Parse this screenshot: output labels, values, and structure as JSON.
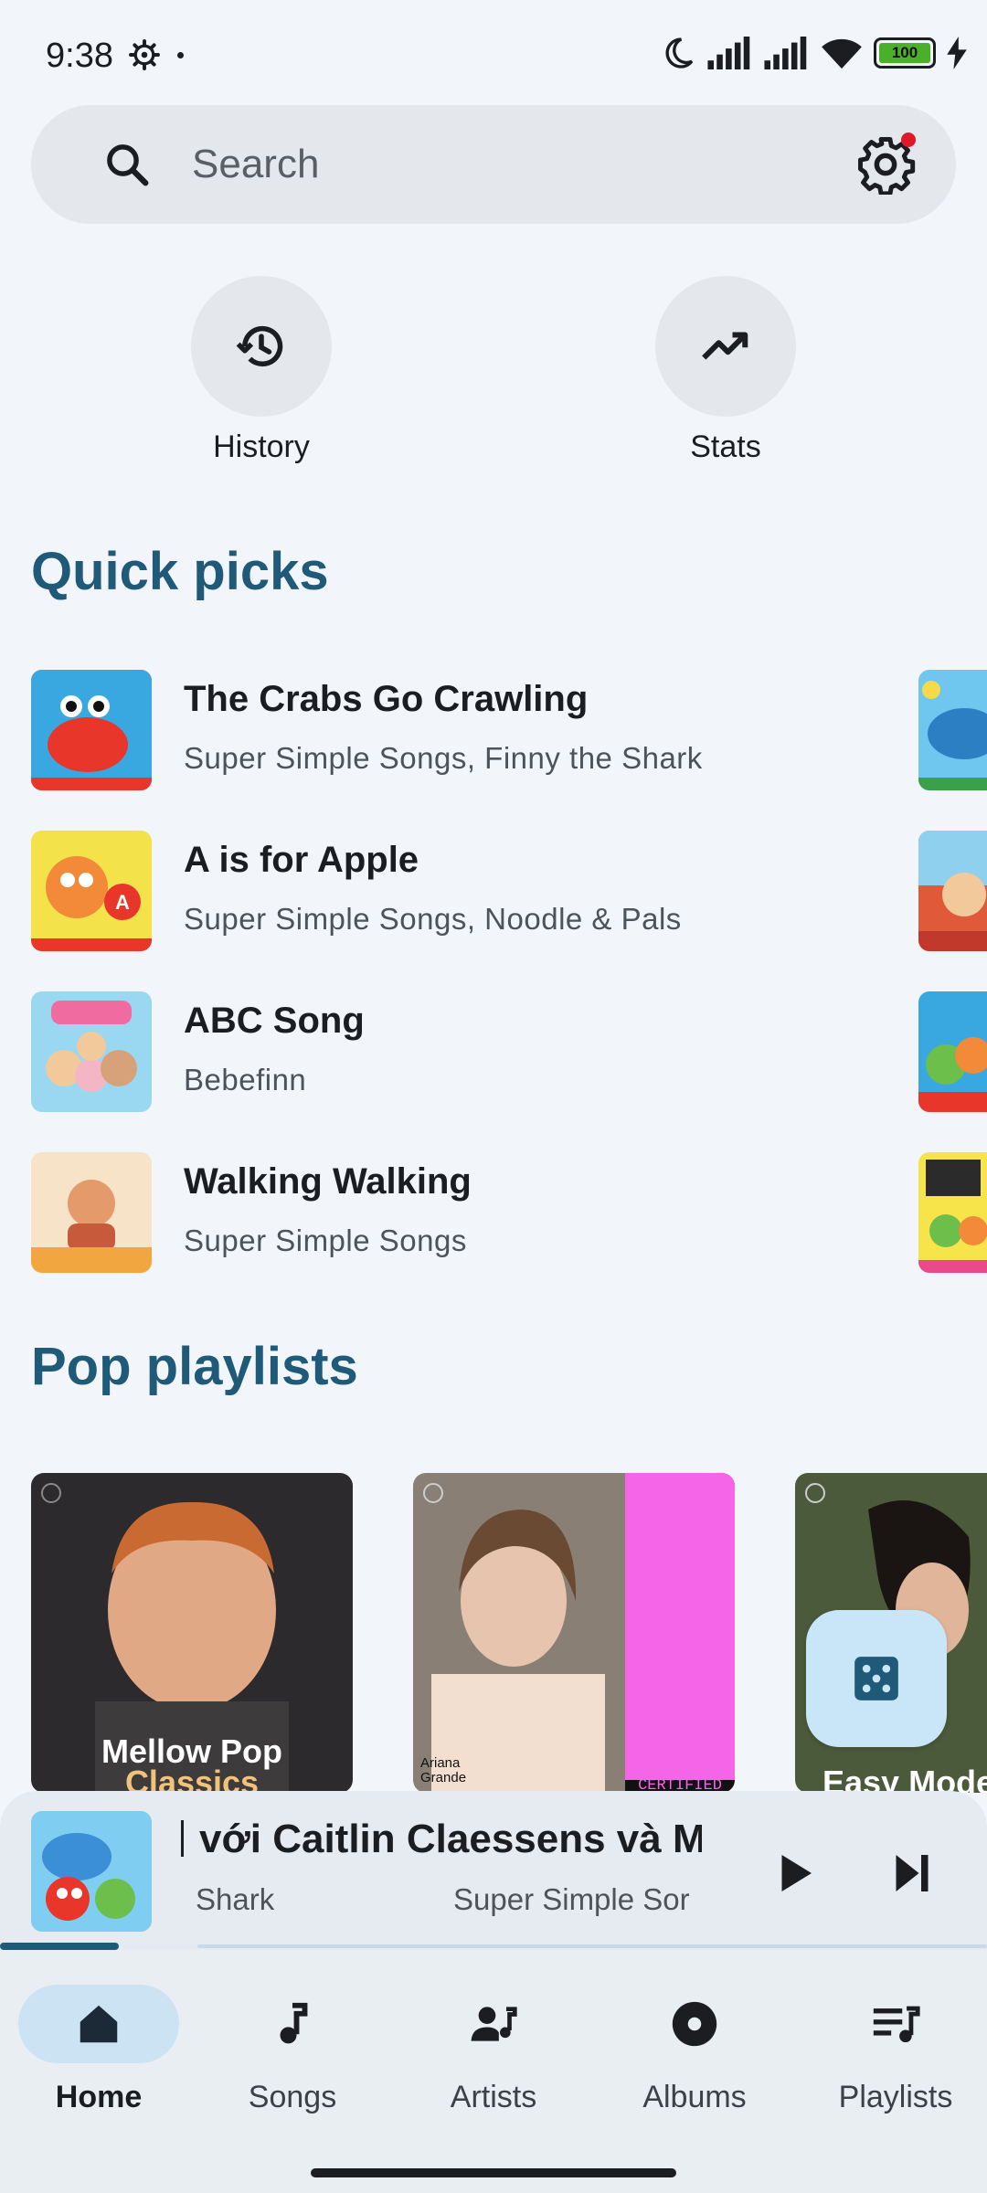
{
  "status_bar": {
    "time": "9:38",
    "battery": "100"
  },
  "search": {
    "placeholder": "Search"
  },
  "quick_actions": [
    {
      "label": "History",
      "icon": "history-icon"
    },
    {
      "label": "Stats",
      "icon": "trending-up-icon"
    }
  ],
  "quick_picks": {
    "title": "Quick picks",
    "items": [
      {
        "title": "The Crabs Go Crawling",
        "subtitle": "Super Simple Songs, Finny the Shark",
        "thumb_color": "#e8362b"
      },
      {
        "title": "A is for Apple",
        "subtitle": "Super Simple Songs, Noodle & Pals",
        "thumb_color": "#f3e24a"
      },
      {
        "title": "ABC Song",
        "subtitle": "Bebefinn",
        "thumb_color": "#8fd0ef"
      },
      {
        "title": "Walking Walking",
        "subtitle": "Super Simple Songs",
        "thumb_color": "#f1c99b"
      }
    ]
  },
  "pop_playlists": {
    "title": "Pop playlists",
    "items": [
      {
        "caption_line1": "Mellow Pop",
        "caption_line2": "Classics"
      },
      {
        "caption_line1": "",
        "caption_line2": ""
      },
      {
        "caption_line1": "Easy Mode",
        "caption_line2": ""
      }
    ],
    "card2_artist_line1": "Ariana",
    "card2_artist_line2": "Grande",
    "card2_badge": "CERTIFIED"
  },
  "now_playing": {
    "title": "với Caitlin Claessens và M",
    "subtitle_left": "Shark",
    "subtitle_right": "Super Simple Sor",
    "progress": 0.12
  },
  "bottom_nav": [
    {
      "label": "Home",
      "icon": "home-icon",
      "active": true
    },
    {
      "label": "Songs",
      "icon": "music-note-icon",
      "active": false
    },
    {
      "label": "Artists",
      "icon": "artist-icon",
      "active": false
    },
    {
      "label": "Albums",
      "icon": "album-icon",
      "active": false
    },
    {
      "label": "Playlists",
      "icon": "playlist-icon",
      "active": false
    }
  ],
  "colors": {
    "accent": "#1f5a78",
    "background": "#f2f6fb",
    "nav_active": "#cbe3f3"
  }
}
